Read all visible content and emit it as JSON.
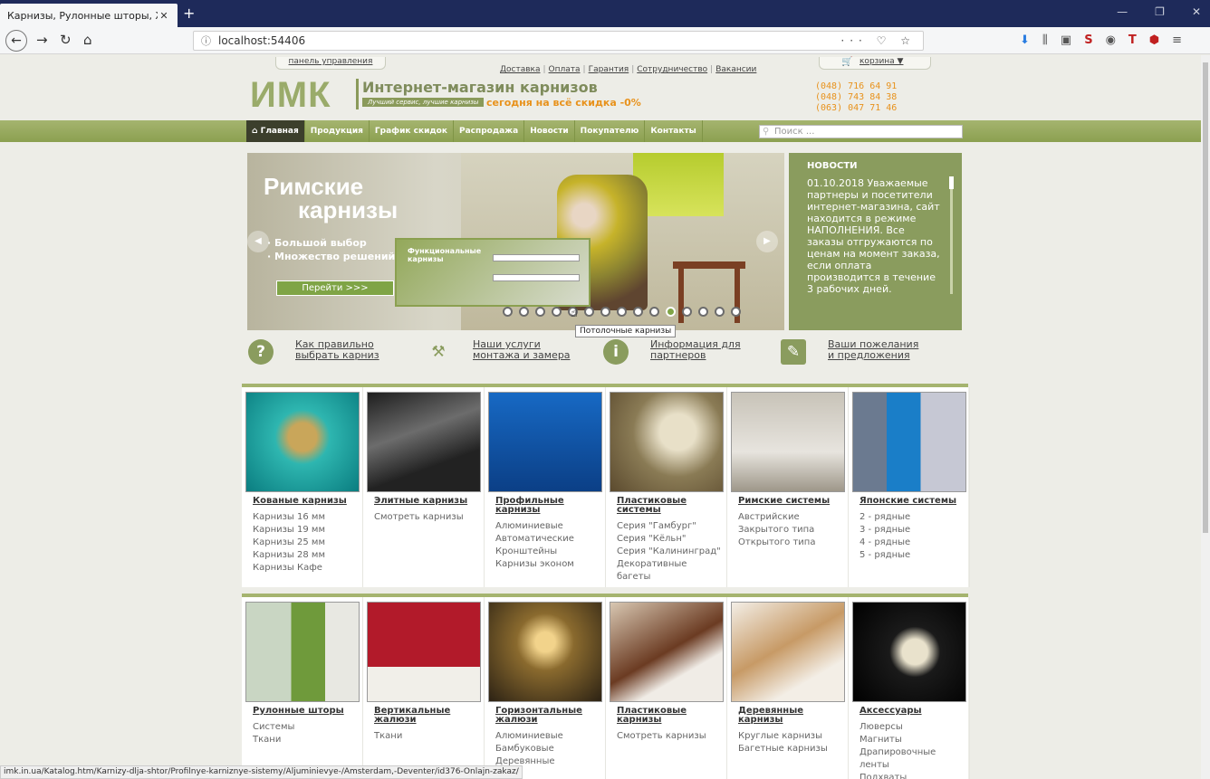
{
  "browser": {
    "tab_title": "Карнизы, Рулонные шторы, Жалю",
    "url": "localhost:54406",
    "status_url": "imk.in.ua/Katalog.htm/Karnizy-dlja-shtor/Profilnye-karniznye-sistemy/Aljuminievye-/Amsterdam,-Deventer/id376-Onlajn-zakaz/"
  },
  "header": {
    "panel_link": "панель управления",
    "info_links": [
      "Доставка",
      "Оплата",
      "Гарантия",
      "Сотрудничество",
      "Вакансии"
    ],
    "cart_label": "корзина ▼",
    "logo": "ИМК",
    "slogan": "Интернет-магазин карнизов",
    "subslogan": "Лучший сервис, лучшие карнизы",
    "discount": "сегодня на всё скидка -0%",
    "phones": [
      "(048) 716 64 91",
      "(048) 743 84 38",
      "(063) 047 71 46"
    ]
  },
  "menu": {
    "items": [
      "Главная",
      "Продукция",
      "График скидок",
      "Распродажа",
      "Новости",
      "Покупателю",
      "Контакты"
    ],
    "search_placeholder": "Поиск ..."
  },
  "slider": {
    "title1": "Римские",
    "title2": "карнизы",
    "bullet1": "· Большой выбор",
    "bullet2": "· Множество решений",
    "button": "Перейти >>>",
    "preview_title": "Функциональные карнизы",
    "tooltip": "Потолочные карнизы",
    "active_dot": 10
  },
  "news": {
    "heading": "НОВОСТИ",
    "text": "01.10.2018 Уважаемые партнеры и посетители интернет-магазина, сайт находится в режиме НАПОЛНЕНИЯ. Все заказы отгружаются по ценам на момент заказа, если оплата производится в течение 3 рабочих дней."
  },
  "help": [
    {
      "label": "Как правильно выбрать карниз",
      "icon": "?"
    },
    {
      "label": "Наши услуги монтажа и замера",
      "icon": "⚒"
    },
    {
      "label": "Информация для партнеров",
      "icon": "i"
    },
    {
      "label": "Ваши пожелания и предложения",
      "icon": "✎"
    }
  ],
  "catalog_row1": [
    {
      "title": "Кованые карнизы",
      "links": [
        "Карнизы 16 мм",
        "Карнизы 19 мм",
        "Карнизы 25 мм",
        "Карнизы 28 мм",
        "Карнизы Кафе"
      ]
    },
    {
      "title": "Элитные карнизы",
      "links": [
        "Смотреть карнизы"
      ]
    },
    {
      "title": "Профильные карнизы",
      "links": [
        "Алюминиевые",
        "Автоматические",
        "Кронштейны",
        "Карнизы эконом"
      ]
    },
    {
      "title": "Пластиковые системы",
      "links": [
        "Серия \"Гамбург\"",
        "Серия \"Кёльн\"",
        "Серия \"Калининград\"",
        "Декоративные багеты"
      ]
    },
    {
      "title": "Римские системы",
      "links": [
        "Австрийские",
        "Закрытого типа",
        "Открытого типа"
      ]
    },
    {
      "title": "Японские системы",
      "links": [
        "2 - рядные",
        "3 - рядные",
        "4 - рядные",
        "5 - рядные"
      ]
    }
  ],
  "catalog_row2": [
    {
      "title": "Рулонные шторы",
      "links": [
        "Системы",
        "Ткани"
      ]
    },
    {
      "title": "Вертикальные жалюзи",
      "links": [
        "Ткани"
      ]
    },
    {
      "title": "Горизонтальные жалюзи",
      "links": [
        "Алюминиевые",
        "Бамбуковые",
        "Деревянные"
      ]
    },
    {
      "title": "Пластиковые карнизы",
      "links": [
        "Смотреть карнизы"
      ]
    },
    {
      "title": "Деревянные карнизы",
      "links": [
        "Круглые карнизы",
        "Багетные карнизы"
      ]
    },
    {
      "title": "Аксессуары",
      "links": [
        "Люверсы",
        "Магниты",
        "Драпировочные ленты",
        "Подхваты"
      ]
    }
  ],
  "colors": {
    "accent_green": "#8ba050",
    "orange": "#e8921c",
    "browser_titlebar": "#1e2a5a"
  }
}
